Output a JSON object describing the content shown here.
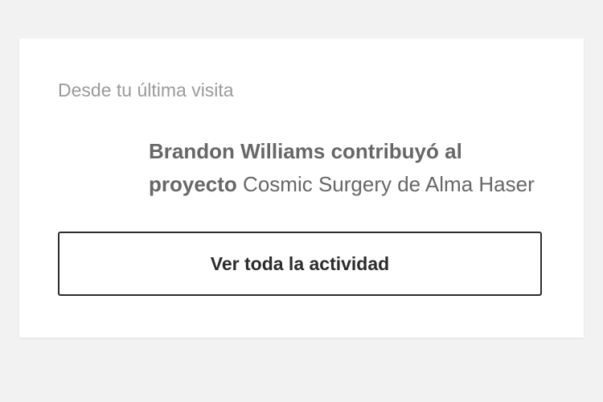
{
  "section": {
    "label": "Desde tu última visita"
  },
  "activity": {
    "user_action": "Brandon Williams contribuyó al",
    "object_type": "proyecto",
    "project_name": "Cosmic Surgery de Alma Haser"
  },
  "button": {
    "label": "Ver toda la actividad"
  }
}
